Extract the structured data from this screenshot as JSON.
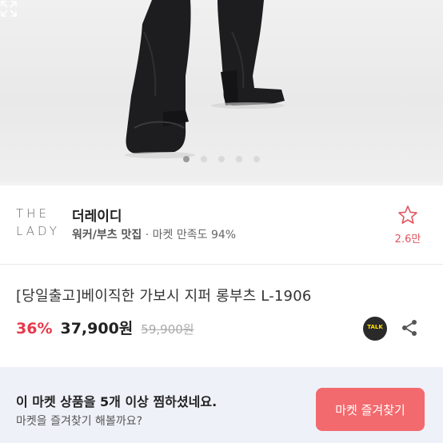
{
  "gallery": {
    "image_alt": "black platform heel long boots",
    "slide_count": 5,
    "active_index": 0,
    "expand_icon": "expand-icon"
  },
  "seller": {
    "logo_line1": "THE",
    "logo_line2": "LADY",
    "name": "더레이디",
    "category": "워커/부츠 맛집",
    "separator": "·",
    "satisfaction": "마켓 만족도 94%",
    "favorite_icon": "star-outline-icon",
    "favorite_count": "2.6만"
  },
  "product": {
    "title": "[당일출고]베이직한 가보시 지퍼 롱부츠 L-1906",
    "discount": "36%",
    "price": "37,900원",
    "original_price": "59,900원",
    "talk_label": "TALK",
    "share_icon": "share-icon"
  },
  "banner": {
    "title": "이 마켓 상품을 5개 이상 찜하셨네요.",
    "subtitle": "마켓을 즐겨찾기 해볼까요?",
    "button_label": "마켓 즐겨찾기"
  },
  "colors": {
    "accent": "#e8394a",
    "button": "#f26a6e",
    "banner_bg": "#eef1f8",
    "favorite": "#e0555f"
  }
}
